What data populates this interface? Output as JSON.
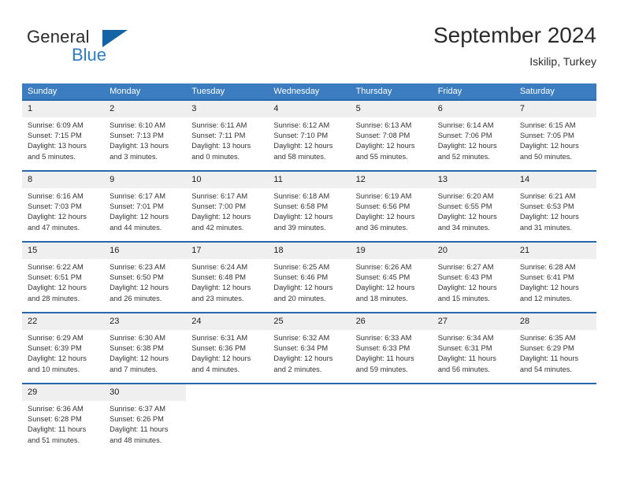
{
  "brand": {
    "word_general": "General",
    "word_blue": "Blue",
    "logo_icon": "triangle-logo-icon",
    "accent_color": "#1464a5",
    "blue_text_color": "#2d7dc4"
  },
  "header": {
    "title": "September 2024",
    "location": "Iskilip, Turkey"
  },
  "calendar": {
    "header_bg": "#3b7dc0",
    "week_border_color": "#2768ab",
    "daynum_bg": "#efefef",
    "weekdays": [
      "Sunday",
      "Monday",
      "Tuesday",
      "Wednesday",
      "Thursday",
      "Friday",
      "Saturday"
    ],
    "weeks": [
      [
        {
          "day": "1",
          "sunrise": "Sunrise: 6:09 AM",
          "sunset": "Sunset: 7:15 PM",
          "daylight_1": "Daylight: 13 hours",
          "daylight_2": "and 5 minutes."
        },
        {
          "day": "2",
          "sunrise": "Sunrise: 6:10 AM",
          "sunset": "Sunset: 7:13 PM",
          "daylight_1": "Daylight: 13 hours",
          "daylight_2": "and 3 minutes."
        },
        {
          "day": "3",
          "sunrise": "Sunrise: 6:11 AM",
          "sunset": "Sunset: 7:11 PM",
          "daylight_1": "Daylight: 13 hours",
          "daylight_2": "and 0 minutes."
        },
        {
          "day": "4",
          "sunrise": "Sunrise: 6:12 AM",
          "sunset": "Sunset: 7:10 PM",
          "daylight_1": "Daylight: 12 hours",
          "daylight_2": "and 58 minutes."
        },
        {
          "day": "5",
          "sunrise": "Sunrise: 6:13 AM",
          "sunset": "Sunset: 7:08 PM",
          "daylight_1": "Daylight: 12 hours",
          "daylight_2": "and 55 minutes."
        },
        {
          "day": "6",
          "sunrise": "Sunrise: 6:14 AM",
          "sunset": "Sunset: 7:06 PM",
          "daylight_1": "Daylight: 12 hours",
          "daylight_2": "and 52 minutes."
        },
        {
          "day": "7",
          "sunrise": "Sunrise: 6:15 AM",
          "sunset": "Sunset: 7:05 PM",
          "daylight_1": "Daylight: 12 hours",
          "daylight_2": "and 50 minutes."
        }
      ],
      [
        {
          "day": "8",
          "sunrise": "Sunrise: 6:16 AM",
          "sunset": "Sunset: 7:03 PM",
          "daylight_1": "Daylight: 12 hours",
          "daylight_2": "and 47 minutes."
        },
        {
          "day": "9",
          "sunrise": "Sunrise: 6:17 AM",
          "sunset": "Sunset: 7:01 PM",
          "daylight_1": "Daylight: 12 hours",
          "daylight_2": "and 44 minutes."
        },
        {
          "day": "10",
          "sunrise": "Sunrise: 6:17 AM",
          "sunset": "Sunset: 7:00 PM",
          "daylight_1": "Daylight: 12 hours",
          "daylight_2": "and 42 minutes."
        },
        {
          "day": "11",
          "sunrise": "Sunrise: 6:18 AM",
          "sunset": "Sunset: 6:58 PM",
          "daylight_1": "Daylight: 12 hours",
          "daylight_2": "and 39 minutes."
        },
        {
          "day": "12",
          "sunrise": "Sunrise: 6:19 AM",
          "sunset": "Sunset: 6:56 PM",
          "daylight_1": "Daylight: 12 hours",
          "daylight_2": "and 36 minutes."
        },
        {
          "day": "13",
          "sunrise": "Sunrise: 6:20 AM",
          "sunset": "Sunset: 6:55 PM",
          "daylight_1": "Daylight: 12 hours",
          "daylight_2": "and 34 minutes."
        },
        {
          "day": "14",
          "sunrise": "Sunrise: 6:21 AM",
          "sunset": "Sunset: 6:53 PM",
          "daylight_1": "Daylight: 12 hours",
          "daylight_2": "and 31 minutes."
        }
      ],
      [
        {
          "day": "15",
          "sunrise": "Sunrise: 6:22 AM",
          "sunset": "Sunset: 6:51 PM",
          "daylight_1": "Daylight: 12 hours",
          "daylight_2": "and 28 minutes."
        },
        {
          "day": "16",
          "sunrise": "Sunrise: 6:23 AM",
          "sunset": "Sunset: 6:50 PM",
          "daylight_1": "Daylight: 12 hours",
          "daylight_2": "and 26 minutes."
        },
        {
          "day": "17",
          "sunrise": "Sunrise: 6:24 AM",
          "sunset": "Sunset: 6:48 PM",
          "daylight_1": "Daylight: 12 hours",
          "daylight_2": "and 23 minutes."
        },
        {
          "day": "18",
          "sunrise": "Sunrise: 6:25 AM",
          "sunset": "Sunset: 6:46 PM",
          "daylight_1": "Daylight: 12 hours",
          "daylight_2": "and 20 minutes."
        },
        {
          "day": "19",
          "sunrise": "Sunrise: 6:26 AM",
          "sunset": "Sunset: 6:45 PM",
          "daylight_1": "Daylight: 12 hours",
          "daylight_2": "and 18 minutes."
        },
        {
          "day": "20",
          "sunrise": "Sunrise: 6:27 AM",
          "sunset": "Sunset: 6:43 PM",
          "daylight_1": "Daylight: 12 hours",
          "daylight_2": "and 15 minutes."
        },
        {
          "day": "21",
          "sunrise": "Sunrise: 6:28 AM",
          "sunset": "Sunset: 6:41 PM",
          "daylight_1": "Daylight: 12 hours",
          "daylight_2": "and 12 minutes."
        }
      ],
      [
        {
          "day": "22",
          "sunrise": "Sunrise: 6:29 AM",
          "sunset": "Sunset: 6:39 PM",
          "daylight_1": "Daylight: 12 hours",
          "daylight_2": "and 10 minutes."
        },
        {
          "day": "23",
          "sunrise": "Sunrise: 6:30 AM",
          "sunset": "Sunset: 6:38 PM",
          "daylight_1": "Daylight: 12 hours",
          "daylight_2": "and 7 minutes."
        },
        {
          "day": "24",
          "sunrise": "Sunrise: 6:31 AM",
          "sunset": "Sunset: 6:36 PM",
          "daylight_1": "Daylight: 12 hours",
          "daylight_2": "and 4 minutes."
        },
        {
          "day": "25",
          "sunrise": "Sunrise: 6:32 AM",
          "sunset": "Sunset: 6:34 PM",
          "daylight_1": "Daylight: 12 hours",
          "daylight_2": "and 2 minutes."
        },
        {
          "day": "26",
          "sunrise": "Sunrise: 6:33 AM",
          "sunset": "Sunset: 6:33 PM",
          "daylight_1": "Daylight: 11 hours",
          "daylight_2": "and 59 minutes."
        },
        {
          "day": "27",
          "sunrise": "Sunrise: 6:34 AM",
          "sunset": "Sunset: 6:31 PM",
          "daylight_1": "Daylight: 11 hours",
          "daylight_2": "and 56 minutes."
        },
        {
          "day": "28",
          "sunrise": "Sunrise: 6:35 AM",
          "sunset": "Sunset: 6:29 PM",
          "daylight_1": "Daylight: 11 hours",
          "daylight_2": "and 54 minutes."
        }
      ],
      [
        {
          "day": "29",
          "sunrise": "Sunrise: 6:36 AM",
          "sunset": "Sunset: 6:28 PM",
          "daylight_1": "Daylight: 11 hours",
          "daylight_2": "and 51 minutes."
        },
        {
          "day": "30",
          "sunrise": "Sunrise: 6:37 AM",
          "sunset": "Sunset: 6:26 PM",
          "daylight_1": "Daylight: 11 hours",
          "daylight_2": "and 48 minutes."
        },
        {
          "day": "",
          "sunrise": "",
          "sunset": "",
          "daylight_1": "",
          "daylight_2": ""
        },
        {
          "day": "",
          "sunrise": "",
          "sunset": "",
          "daylight_1": "",
          "daylight_2": ""
        },
        {
          "day": "",
          "sunrise": "",
          "sunset": "",
          "daylight_1": "",
          "daylight_2": ""
        },
        {
          "day": "",
          "sunrise": "",
          "sunset": "",
          "daylight_1": "",
          "daylight_2": ""
        },
        {
          "day": "",
          "sunrise": "",
          "sunset": "",
          "daylight_1": "",
          "daylight_2": ""
        }
      ]
    ]
  }
}
